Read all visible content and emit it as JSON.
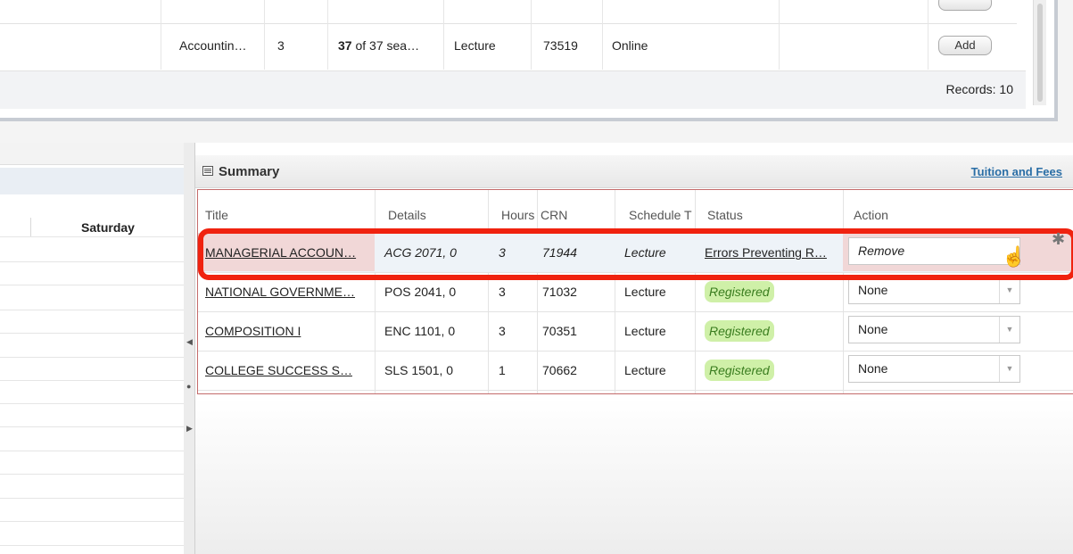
{
  "results": {
    "row": {
      "subject": "Accountin…",
      "hours": "3",
      "seats_bold": "37",
      "seats_rest": " of 37 sea…",
      "schedule_type": "Lecture",
      "crn": "73519",
      "campus": "Online"
    },
    "add_label": "Add",
    "records": "Records: 10"
  },
  "schedule": {
    "day": "Saturday"
  },
  "summary": {
    "title": "Summary",
    "fees_link": "Tuition and Fees",
    "headers": {
      "title": "Title",
      "details": "Details",
      "hours": "Hours",
      "crn": "CRN",
      "schedule": "Schedule T",
      "status": "Status",
      "action": "Action"
    },
    "rows": [
      {
        "title": "MANAGERIAL ACCOUN…",
        "details": "ACG 2071, 0",
        "hours": "3",
        "crn": "71944",
        "schedule": "Lecture",
        "status": "Errors Preventing R…",
        "action": "Remove"
      },
      {
        "title": "NATIONAL GOVERNME…",
        "details": "POS 2041, 0",
        "hours": "3",
        "crn": "71032",
        "schedule": "Lecture",
        "status": "Registered",
        "action": "None"
      },
      {
        "title": "COMPOSITION I",
        "details": "ENC 1101, 0",
        "hours": "3",
        "crn": "70351",
        "schedule": "Lecture",
        "status": "Registered",
        "action": "None"
      },
      {
        "title": "COLLEGE SUCCESS S…",
        "details": "SLS 1501, 0",
        "hours": "1",
        "crn": "70662",
        "schedule": "Lecture",
        "status": "Registered",
        "action": "None"
      }
    ]
  },
  "colors": {
    "highlight": "#f0220f",
    "registered_bg": "#cff0a8",
    "error_row": "#f1d7d7",
    "link": "#2a6ea6"
  },
  "icons": [
    "summary-icon",
    "gear-icon",
    "hand-cursor-icon",
    "chevron-down-icon"
  ]
}
